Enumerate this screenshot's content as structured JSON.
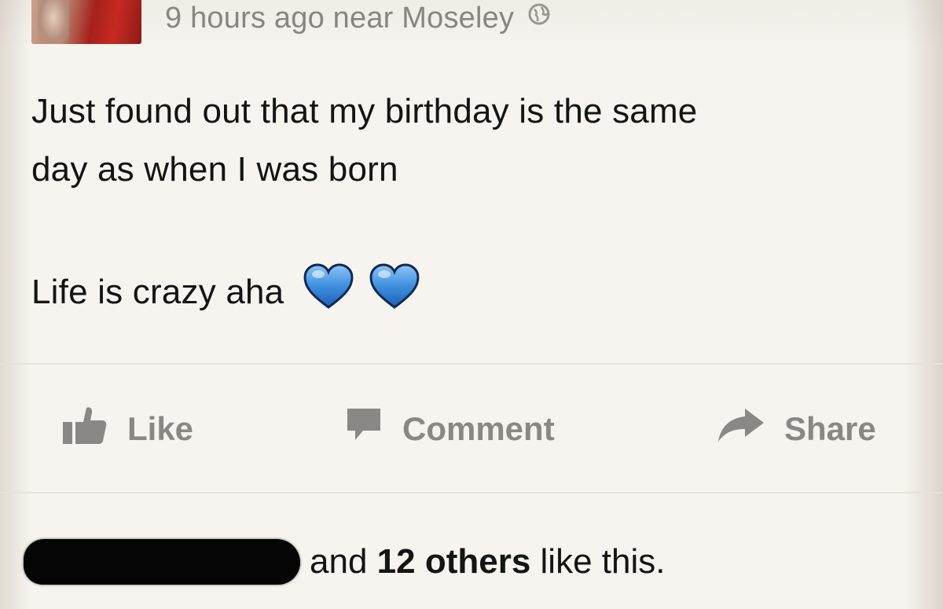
{
  "post": {
    "timestamp": "9 hours ago near Moseley",
    "text_line1": "Just found out that my birthday is the same",
    "text_line2": "day as when I was born",
    "text_line3": "Life is crazy aha"
  },
  "emoji": [
    "blue-heart",
    "blue-heart"
  ],
  "actions": {
    "like": "Like",
    "comment": "Comment",
    "share": "Share"
  },
  "likes": {
    "prefix": "and",
    "count": "12 others",
    "suffix": "like this."
  },
  "colors": {
    "background": "#f7f4ef",
    "meta_text": "#8a8580",
    "action_text": "#8b8784",
    "heart_blue": "#3f8fe0"
  }
}
